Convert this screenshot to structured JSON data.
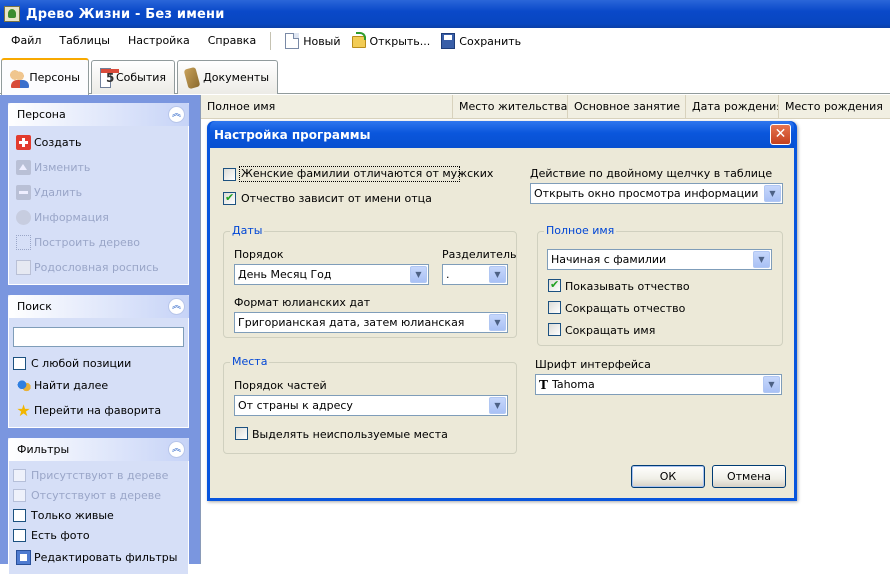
{
  "window": {
    "title": "Древо Жизни - Без имени"
  },
  "menu": [
    "Файл",
    "Таблицы",
    "Настройка",
    "Справка"
  ],
  "toolbar": {
    "new": "Новый",
    "open": "Открыть...",
    "save": "Сохранить"
  },
  "tabs": [
    "Персоны",
    "События",
    "Документы"
  ],
  "left": {
    "person": {
      "title": "Персона",
      "items": [
        "Создать",
        "Изменить",
        "Удалить",
        "Информация",
        "Построить дерево",
        "Родословная роспись"
      ]
    },
    "search": {
      "title": "Поиск",
      "query": "",
      "any_position": "С любой позиции",
      "find_next": "Найти далее",
      "goto_favorite": "Перейти на фаворита"
    },
    "filters": {
      "title": "Фильтры",
      "present": "Присутствуют в дереве",
      "absent": "Отсутствуют в дереве",
      "alive": "Только живые",
      "photo": "Есть фото",
      "edit": "Редактировать фильтры"
    }
  },
  "grid": {
    "columns": [
      "Полное имя",
      "Место жительства",
      "Основное занятие",
      "Дата рождения",
      "Место рождения"
    ]
  },
  "dialog": {
    "title": "Настройка программы",
    "female_surnames": "Женские фамилии отличаются от мужских",
    "patronymic": "Отчество зависит от имени отца",
    "dblclick_label": "Действие по двойному щелчку в таблице",
    "dblclick_value": "Открыть окно просмотра информации",
    "dates": {
      "legend": "Даты",
      "order_label": "Порядок",
      "order_value": "День Месяц Год",
      "sep_label": "Разделитель",
      "sep_value": ".",
      "julian_label": "Формат юлианских дат",
      "julian_value": "Григорианская дата, затем юлианская"
    },
    "places": {
      "legend": "Места",
      "order_label": "Порядок частей",
      "order_value": "От страны к адресу",
      "highlight_unused": "Выделять неиспользуемые места"
    },
    "fullname": {
      "legend": "Полное имя",
      "order_value": "Начиная с фамилии",
      "show_patronymic": "Показывать отчество",
      "shorten_patronymic": "Сокращать отчество",
      "shorten_name": "Сокращать имя"
    },
    "font_label": "Шрифт интерфейса",
    "font_value": "Tahoma",
    "ok": "ОК",
    "cancel": "Отмена"
  }
}
